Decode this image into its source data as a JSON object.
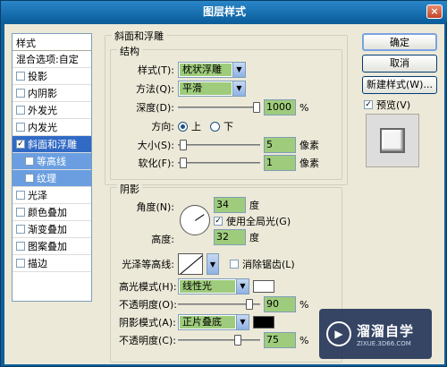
{
  "window": {
    "title": "图层样式",
    "close": "×"
  },
  "sidebar": {
    "header": "样式",
    "blend": "混合选项:自定",
    "items": [
      {
        "label": "投影",
        "checked": false
      },
      {
        "label": "内阴影",
        "checked": false
      },
      {
        "label": "外发光",
        "checked": false
      },
      {
        "label": "内发光",
        "checked": false
      },
      {
        "label": "斜面和浮雕",
        "checked": true
      },
      {
        "label": "等高线",
        "checked": false
      },
      {
        "label": "纹理",
        "checked": false
      },
      {
        "label": "光泽",
        "checked": false
      },
      {
        "label": "颜色叠加",
        "checked": false
      },
      {
        "label": "渐变叠加",
        "checked": false
      },
      {
        "label": "图案叠加",
        "checked": false
      },
      {
        "label": "描边",
        "checked": false
      }
    ]
  },
  "bevel": {
    "group_title": "斜面和浮雕",
    "structure_title": "结构",
    "style_label": "样式(T):",
    "style_value": "枕状浮雕",
    "technique_label": "方法(Q):",
    "technique_value": "平滑",
    "depth_label": "深度(D):",
    "depth_value": "1000",
    "depth_unit": "%",
    "depth_level": 1.0,
    "direction_label": "方向:",
    "direction_up": "上",
    "direction_down": "下",
    "size_label": "大小(S):",
    "size_value": "5",
    "size_unit": "像素",
    "size_level": 0.02,
    "soften_label": "软化(F):",
    "soften_value": "1",
    "soften_unit": "像素",
    "soften_level": 0.02
  },
  "shading": {
    "title": "阴影",
    "angle_label": "角度(N):",
    "angle_value": "34",
    "angle_unit": "度",
    "global_light_label": "使用全局光(G)",
    "altitude_label": "高度:",
    "altitude_value": "32",
    "altitude_unit": "度",
    "gloss_label": "光泽等高线:",
    "antialias_label": "消除锯齿(L)",
    "highlight_label": "高光模式(H):",
    "highlight_value": "线性光",
    "highlight_color": "#ffffff",
    "highlight_opacity_label": "不透明度(O):",
    "highlight_opacity_value": "90",
    "highlight_opacity_unit": "%",
    "highlight_opacity_level": 0.9,
    "shadow_label": "阴影模式(A):",
    "shadow_value": "正片叠底",
    "shadow_color": "#000000",
    "shadow_opacity_label": "不透明度(C):",
    "shadow_opacity_value": "75",
    "shadow_opacity_unit": "%",
    "shadow_opacity_level": 0.75
  },
  "buttons": {
    "ok": "确定",
    "cancel": "取消",
    "new_style": "新建样式(W)...",
    "preview": "预览(V)"
  },
  "watermark": {
    "brand": "溜溜自学",
    "url": "ZIXUE.3D66.COM"
  }
}
